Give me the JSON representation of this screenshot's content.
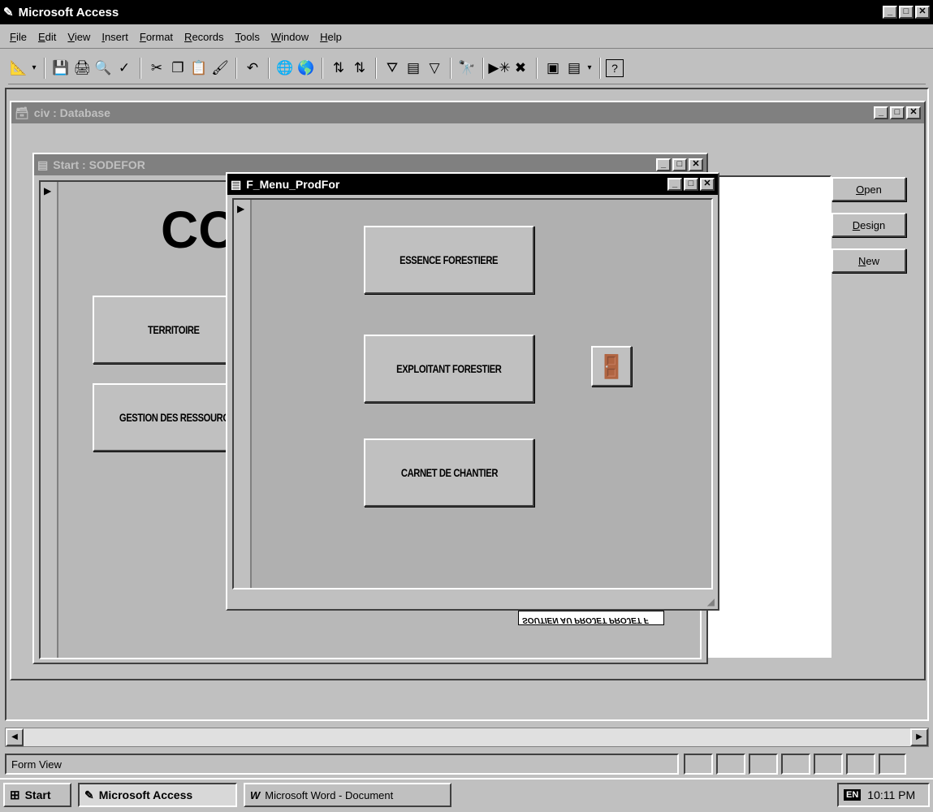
{
  "app": {
    "title": "Microsoft Access",
    "menu": [
      "File",
      "Edit",
      "View",
      "Insert",
      "Format",
      "Records",
      "Tools",
      "Window",
      "Help"
    ]
  },
  "db_window": {
    "title": "civ : Database",
    "buttons": {
      "open": "Open",
      "design": "Design",
      "new": "New"
    }
  },
  "start_form": {
    "title": "Start : SODEFOR",
    "heading": "CO",
    "buttons": {
      "territoire": "TERRITOIRE",
      "gestion": "GESTION DES RESSOURC"
    },
    "partial_label": "SOUTIEN AU PROJET PROJET F"
  },
  "menu_form": {
    "title": "F_Menu_ProdFor",
    "buttons": {
      "essence": "ESSENCE FORESTIERE",
      "exploitant": "EXPLOITANT FORESTIER",
      "carnet": "CARNET DE CHANTIER"
    }
  },
  "status": {
    "text": "Form View"
  },
  "taskbar": {
    "start": "Start",
    "access": "Microsoft Access",
    "word": "Microsoft Word - Document",
    "lang": "EN",
    "time": "10:11 PM"
  }
}
